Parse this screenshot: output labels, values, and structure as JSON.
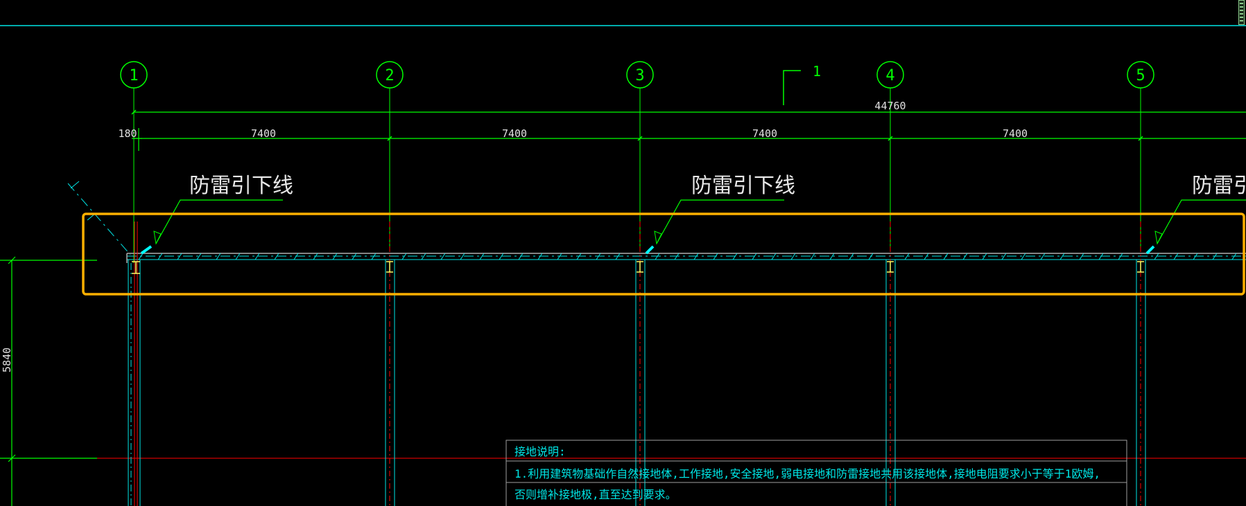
{
  "axes": [
    {
      "label": "1"
    },
    {
      "label": "2"
    },
    {
      "label": "3"
    },
    {
      "label": "4"
    },
    {
      "label": "5"
    }
  ],
  "section_marker": "1",
  "total_dimension": "44760",
  "offset_dimension": "180",
  "span_dimensions": [
    "7400",
    "7400",
    "7400",
    "7400"
  ],
  "height_dimension": "5840",
  "callouts": [
    {
      "text": "防雷引下线"
    },
    {
      "text": "防雷引下线"
    },
    {
      "text": "防雷引"
    }
  ],
  "notes": {
    "title": "接地说明:",
    "line1": "1.利用建筑物基础作自然接地体,工作接地,安全接地,弱电接地和防雷接地共用该接地体,接地电阻要求小于等于1欧姆,",
    "line2": "否则增补接地极,直至达到要求。"
  },
  "colors": {
    "background": "#000000",
    "axis": "#00ff00",
    "column_outline": "#00ffff",
    "red_line": "#ff0000",
    "highlight_box": "#ffb000",
    "marker": "#ffff66"
  }
}
